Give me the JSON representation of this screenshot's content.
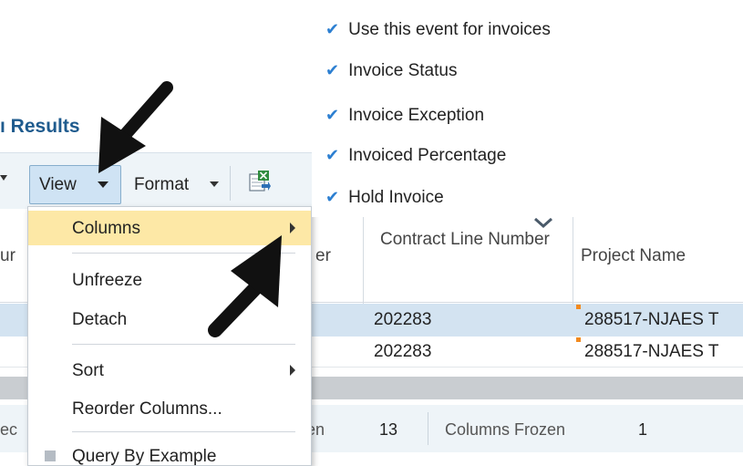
{
  "header": {
    "title": "ı Results"
  },
  "toolbar": {
    "view_label": "View",
    "format_label": "Format",
    "export_icon": "export-to-excel-icon"
  },
  "table": {
    "partial_header_left": "ur",
    "partial_header_er": "er",
    "columns": [
      "Contract Line Number",
      "Project Name"
    ],
    "rows": [
      {
        "contract_line": "202283",
        "project_name": "288517-NJAES T"
      },
      {
        "contract_line": "202283",
        "project_name": "288517-NJAES T"
      }
    ],
    "selected_row": 0
  },
  "footer": {
    "partial_left": "ec",
    "partial_en": "en",
    "count_value": "13",
    "columns_frozen_label": "Columns Frozen",
    "columns_frozen_value": "1"
  },
  "view_menu": {
    "items": [
      {
        "label": "Columns",
        "has_submenu": true,
        "highlighted": true
      },
      {
        "label": "Unfreeze"
      },
      {
        "label": "Detach"
      },
      {
        "label": "Sort",
        "has_submenu": true
      },
      {
        "label": "Reorder Columns..."
      },
      {
        "label": "Query By Example",
        "checkbox": true
      }
    ]
  },
  "columns_submenu": {
    "items": [
      {
        "label": "Use this event for invoices",
        "checked": true
      },
      {
        "label": "Invoice Status",
        "checked": true
      },
      {
        "label": "Invoice Exception",
        "checked": true
      },
      {
        "label": "Invoiced Percentage",
        "checked": true
      },
      {
        "label": "Hold Invoice",
        "checked": true
      }
    ],
    "check_glyph": "✔",
    "scroll_icon": "chevron-down-icon"
  },
  "colors": {
    "accent": "#1f5b8e",
    "menu_highlight": "#fde8a6",
    "selected_row": "#d3e3f1",
    "check": "#2c7fd1",
    "change_marker": "#f28a1f"
  }
}
